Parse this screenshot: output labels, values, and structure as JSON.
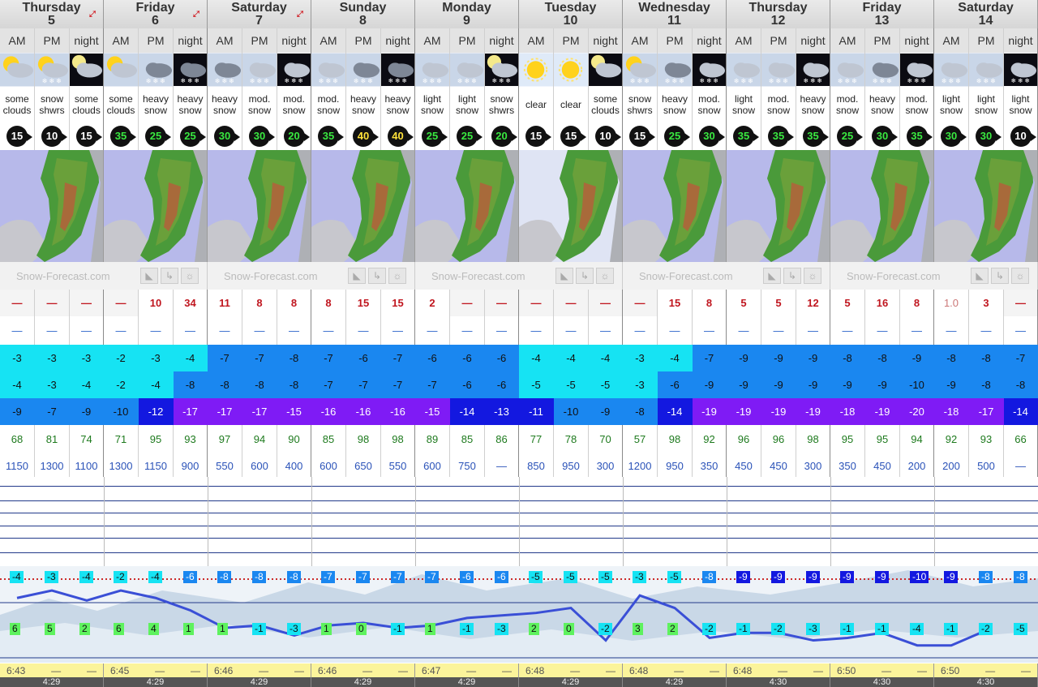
{
  "days": [
    {
      "name": "Thursday",
      "date": "5",
      "expand": true
    },
    {
      "name": "Friday",
      "date": "6",
      "expand": true
    },
    {
      "name": "Saturday",
      "date": "7",
      "expand": true
    },
    {
      "name": "Sunday",
      "date": "8",
      "expand": false
    },
    {
      "name": "Monday",
      "date": "9",
      "expand": false
    },
    {
      "name": "Tuesday",
      "date": "10",
      "expand": false
    },
    {
      "name": "Wednesday",
      "date": "11",
      "expand": false
    },
    {
      "name": "Thursday",
      "date": "12",
      "expand": false
    },
    {
      "name": "Friday",
      "date": "13",
      "expand": false
    },
    {
      "name": "Saturday",
      "date": "14",
      "expand": false
    }
  ],
  "periods": [
    "AM",
    "PM",
    "night"
  ],
  "summary": [
    "some clouds",
    "snow shwrs",
    "some clouds",
    "some clouds",
    "heavy snow",
    "heavy snow",
    "heavy snow",
    "mod. snow",
    "mod. snow",
    "mod. snow",
    "heavy snow",
    "heavy snow",
    "light snow",
    "light snow",
    "snow shwrs",
    "clear",
    "clear",
    "some clouds",
    "snow shwrs",
    "heavy snow",
    "mod. snow",
    "light snow",
    "mod. snow",
    "heavy snow",
    "mod. snow",
    "heavy snow",
    "mod. snow",
    "light snow",
    "light snow",
    "light snow"
  ],
  "icons": [
    "sun-cloud-icon",
    "sun-snow-icon",
    "moon-cloud-icon",
    "sun-cloud-icon",
    "heavy-snow-icon",
    "heavy-snow-night-icon",
    "heavy-snow-icon",
    "snow-icon",
    "snow-night-icon",
    "snow-icon",
    "heavy-snow-icon",
    "heavy-snow-night-icon",
    "snow-icon",
    "snow-icon",
    "moon-snow-icon",
    "sun-icon",
    "sun-icon",
    "moon-cloud-icon",
    "sun-snow-icon",
    "heavy-snow-icon",
    "snow-night-icon",
    "snow-icon",
    "snow-icon",
    "snow-night-icon",
    "snow-icon",
    "heavy-snow-icon",
    "snow-night-icon",
    "snow-icon",
    "snow-icon",
    "snow-night-icon"
  ],
  "wind": [
    {
      "v": "15",
      "c": "w"
    },
    {
      "v": "10",
      "c": "w"
    },
    {
      "v": "15",
      "c": "w"
    },
    {
      "v": "35",
      "c": "g"
    },
    {
      "v": "25",
      "c": "g"
    },
    {
      "v": "25",
      "c": "g"
    },
    {
      "v": "30",
      "c": "g"
    },
    {
      "v": "30",
      "c": "g"
    },
    {
      "v": "20",
      "c": "g"
    },
    {
      "v": "35",
      "c": "g"
    },
    {
      "v": "40",
      "c": "y"
    },
    {
      "v": "40",
      "c": "y"
    },
    {
      "v": "25",
      "c": "g"
    },
    {
      "v": "25",
      "c": "g"
    },
    {
      "v": "20",
      "c": "g"
    },
    {
      "v": "15",
      "c": "w"
    },
    {
      "v": "15",
      "c": "w"
    },
    {
      "v": "10",
      "c": "w"
    },
    {
      "v": "15",
      "c": "w"
    },
    {
      "v": "25",
      "c": "g"
    },
    {
      "v": "30",
      "c": "g"
    },
    {
      "v": "35",
      "c": "g"
    },
    {
      "v": "35",
      "c": "g"
    },
    {
      "v": "35",
      "c": "g"
    },
    {
      "v": "25",
      "c": "g"
    },
    {
      "v": "30",
      "c": "g"
    },
    {
      "v": "35",
      "c": "g"
    },
    {
      "v": "30",
      "c": "g"
    },
    {
      "v": "30",
      "c": "g"
    },
    {
      "v": "10",
      "c": "w"
    }
  ],
  "brand": {
    "text": "Snow-Forecast.com"
  },
  "snow": [
    "—",
    "—",
    "—",
    "—",
    "10",
    "34",
    "11",
    "8",
    "8",
    "8",
    "15",
    "15",
    "2",
    "—",
    "—",
    "—",
    "—",
    "—",
    "—",
    "15",
    "8",
    "5",
    "5",
    "12",
    "5",
    "16",
    "8",
    "1.0",
    "3",
    "—"
  ],
  "rain": [
    "—",
    "—",
    "—",
    "—",
    "—",
    "—",
    "—",
    "—",
    "—",
    "—",
    "—",
    "—",
    "—",
    "—",
    "—",
    "—",
    "—",
    "—",
    "—",
    "—",
    "—",
    "—",
    "—",
    "—",
    "—",
    "—",
    "—",
    "—",
    "—",
    "—"
  ],
  "tmax": [
    "-3",
    "-3",
    "-3",
    "-2",
    "-3",
    "-4",
    "-7",
    "-7",
    "-8",
    "-7",
    "-6",
    "-7",
    "-6",
    "-6",
    "-6",
    "-4",
    "-4",
    "-4",
    "-3",
    "-4",
    "-7",
    "-9",
    "-9",
    "-9",
    "-8",
    "-8",
    "-9",
    "-8",
    "-8",
    "-7"
  ],
  "tmin": [
    "-4",
    "-3",
    "-4",
    "-2",
    "-4",
    "-8",
    "-8",
    "-8",
    "-8",
    "-7",
    "-7",
    "-7",
    "-7",
    "-6",
    "-6",
    "-5",
    "-5",
    "-5",
    "-3",
    "-6",
    "-9",
    "-9",
    "-9",
    "-9",
    "-9",
    "-9",
    "-10",
    "-9",
    "-8",
    "-8"
  ],
  "chill": [
    "-9",
    "-7",
    "-9",
    "-10",
    "-12",
    "-17",
    "-17",
    "-17",
    "-15",
    "-16",
    "-16",
    "-16",
    "-15",
    "-14",
    "-13",
    "-11",
    "-10",
    "-9",
    "-8",
    "-14",
    "-19",
    "-19",
    "-19",
    "-19",
    "-18",
    "-19",
    "-20",
    "-18",
    "-17",
    "-14"
  ],
  "humidity": [
    "68",
    "81",
    "74",
    "71",
    "95",
    "93",
    "97",
    "94",
    "90",
    "85",
    "98",
    "98",
    "89",
    "85",
    "86",
    "77",
    "78",
    "70",
    "57",
    "98",
    "92",
    "96",
    "96",
    "98",
    "95",
    "95",
    "94",
    "92",
    "93",
    "66"
  ],
  "freezing": [
    "1150",
    "1300",
    "1100",
    "1300",
    "1150",
    "900",
    "550",
    "600",
    "400",
    "600",
    "650",
    "550",
    "600",
    "750",
    "—",
    "850",
    "950",
    "300",
    "1200",
    "950",
    "350",
    "450",
    "450",
    "300",
    "350",
    "450",
    "200",
    "200",
    "500",
    "—"
  ],
  "top_temps": [
    "-4",
    "-3",
    "-4",
    "-2",
    "-4",
    "-6",
    "-8",
    "-8",
    "-8",
    "-7",
    "-7",
    "-7",
    "-7",
    "-6",
    "-6",
    "-5",
    "-5",
    "-5",
    "-3",
    "-5",
    "-8",
    "-9",
    "-9",
    "-9",
    "-9",
    "-9",
    "-10",
    "-9",
    "-8",
    "-8"
  ],
  "base_temps": [
    "6",
    "5",
    "2",
    "6",
    "4",
    "1",
    "1",
    "-1",
    "-3",
    "1",
    "0",
    "-1",
    "1",
    "-1",
    "-3",
    "2",
    "0",
    "-2",
    "3",
    "2",
    "-2",
    "-1",
    "-2",
    "-3",
    "-1",
    "-1",
    "-4",
    "-1",
    "-2",
    "-5"
  ],
  "sunrise": [
    "6:43",
    "6:45",
    "6:46",
    "6:46",
    "6:47",
    "6:48",
    "6:48",
    "6:48",
    "6:50",
    "6:50"
  ],
  "sunset": [
    "4:29",
    "4:29",
    "4:29",
    "4:29",
    "4:29",
    "4:29",
    "4:29",
    "4:30",
    "4:30",
    "4:30"
  ],
  "dash": "—",
  "colors": {
    "snow": "#c0161f",
    "rain": "#2a63c9",
    "humidity": "#1e7a1e",
    "freezing": "#2a52b8"
  }
}
